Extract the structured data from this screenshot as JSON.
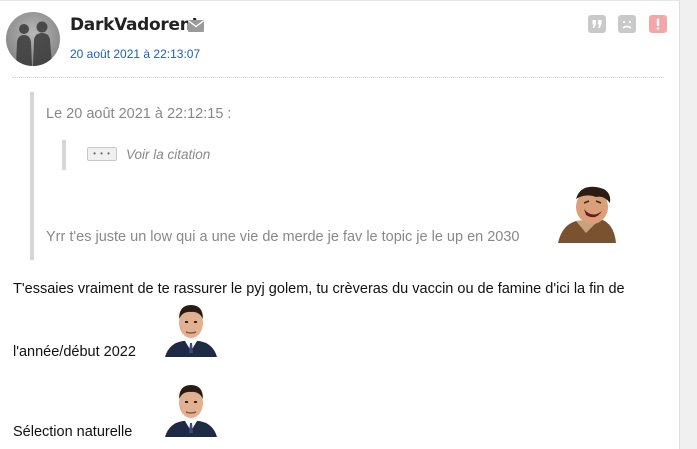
{
  "post": {
    "author": "DarkVadorent",
    "date": "20 août 2021 à 22:13:07",
    "icons": {
      "mail": "envelope-icon",
      "quote": "quote-icon",
      "blacklist": "sad-face-icon",
      "alert": "exclamation-icon"
    },
    "quote": {
      "header": "Le 20 août 2021 à 22:12:15 :",
      "expand_label": "• • •",
      "see_quote": "Voir la citation",
      "message": "Yrr t'es juste un low qui a une vie de merde je fav le topic je le up en 2030"
    },
    "body": {
      "line1": "T'essaies vraiment de te rassurer le pyj golem, tu crèveras du vaccin ou de famine d'ici la fin de",
      "line2": "l'année/début 2022",
      "line3": "Sélection naturelle"
    }
  },
  "colors": {
    "date_link": "#1a5fb4",
    "quote_text": "#888888",
    "alert": "#f3a8a8",
    "action_gray": "#c9c9c9"
  }
}
